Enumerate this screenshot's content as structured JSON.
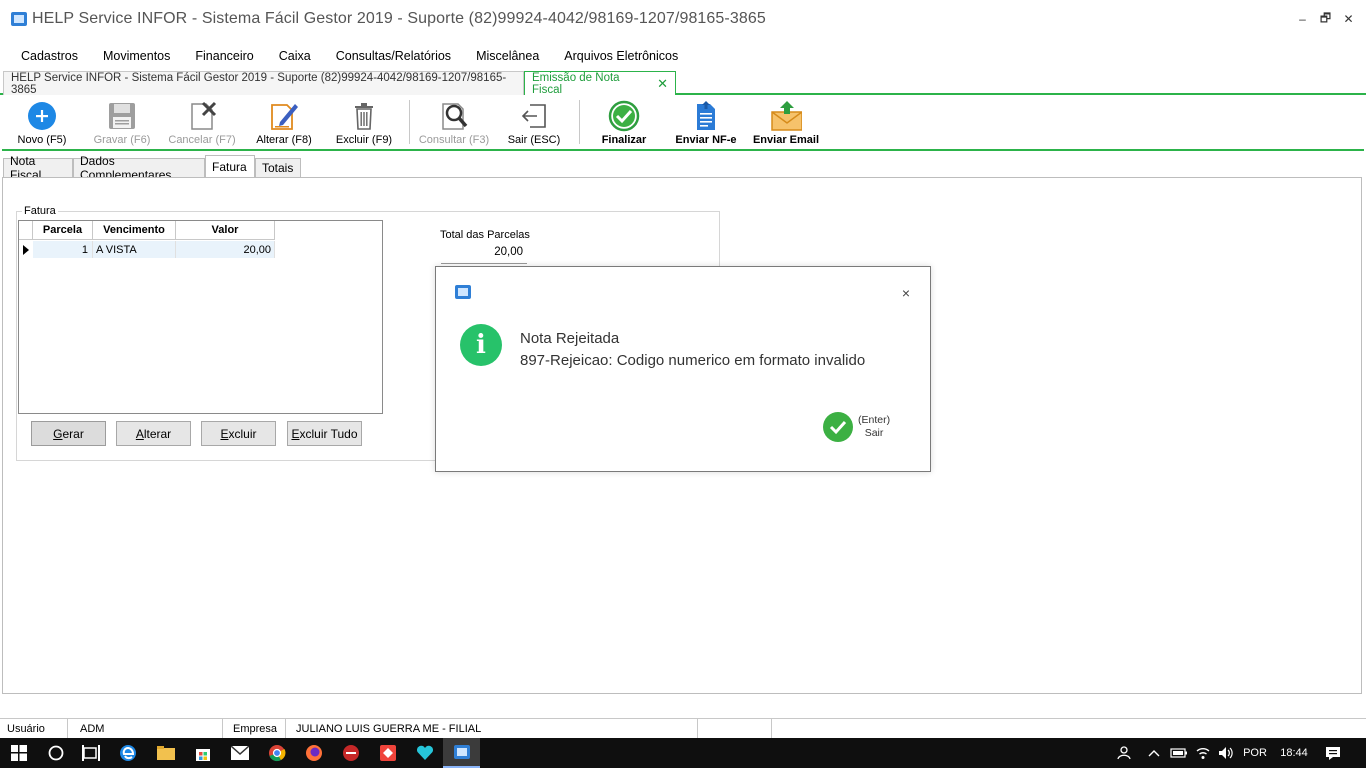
{
  "window": {
    "title": "HELP Service INFOR  -  Sistema Fácil Gestor 2019 -   Suporte (82)99924-4042/98169-1207/98165-3865",
    "minimize": "–",
    "restore": "🗗",
    "close": "✕"
  },
  "menu": [
    "Cadastros",
    "Movimentos",
    "Financeiro",
    "Caixa",
    "Consultas/Relatórios",
    "Miscelânea",
    "Arquivos Eletrônicos"
  ],
  "doc_tabs": [
    {
      "label": "HELP Service INFOR  -  Sistema Fácil Gestor 2019 -   Suporte (82)99924-4042/98169-1207/98165-3865"
    },
    {
      "label": "Emissão de Nota Fiscal",
      "close": "✕"
    }
  ],
  "toolbar": {
    "novo": "Novo (F5)",
    "gravar": "Gravar (F6)",
    "cancelar": "Cancelar (F7)",
    "alterar": "Alterar (F8)",
    "excluir": "Excluir (F9)",
    "consultar": "Consultar (F3)",
    "sair": "Sair (ESC)",
    "finalizar": "Finalizar",
    "enviar_nfe": "Enviar NF-e",
    "enviar_email": "Enviar Email"
  },
  "inner_tabs": [
    "Nota Fiscal",
    "Dados Complementares",
    "Fatura",
    "Totais"
  ],
  "fatura": {
    "group_label": "Fatura",
    "columns": [
      "Parcela",
      "Vencimento",
      "Valor"
    ],
    "rows": [
      {
        "parcela": "1",
        "vencimento": "A VISTA",
        "valor": "20,00"
      }
    ],
    "buttons": {
      "gerar_u": "G",
      "gerar_rest": "erar",
      "alterar_u": "A",
      "alterar_rest": "lterar",
      "excluir_u": "E",
      "excluir_rest": "xcluir",
      "excluir_tudo_u": "E",
      "excluir_tudo_rest": "xcluir Tudo"
    },
    "total_label": "Total das Parcelas",
    "total_value": "20,00"
  },
  "dialog": {
    "close": "×",
    "info_glyph": "i",
    "title": "Nota Rejeitada",
    "message": "897-Rejeicao: Codigo numerico em formato invalido",
    "ok_line1": "(Enter)",
    "ok_line2": "Sair"
  },
  "statusbar": {
    "usuario_label": "Usuário",
    "usuario_value": "ADM",
    "empresa_label": "Empresa",
    "empresa_value": "JULIANO LUIS GUERRA ME - FILIAL"
  },
  "taskbar": {
    "language": "POR",
    "time": "18:44"
  },
  "colors": {
    "accent_green": "#2cb34a",
    "info_green": "#27c26a",
    "blue": "#1e88e5"
  }
}
